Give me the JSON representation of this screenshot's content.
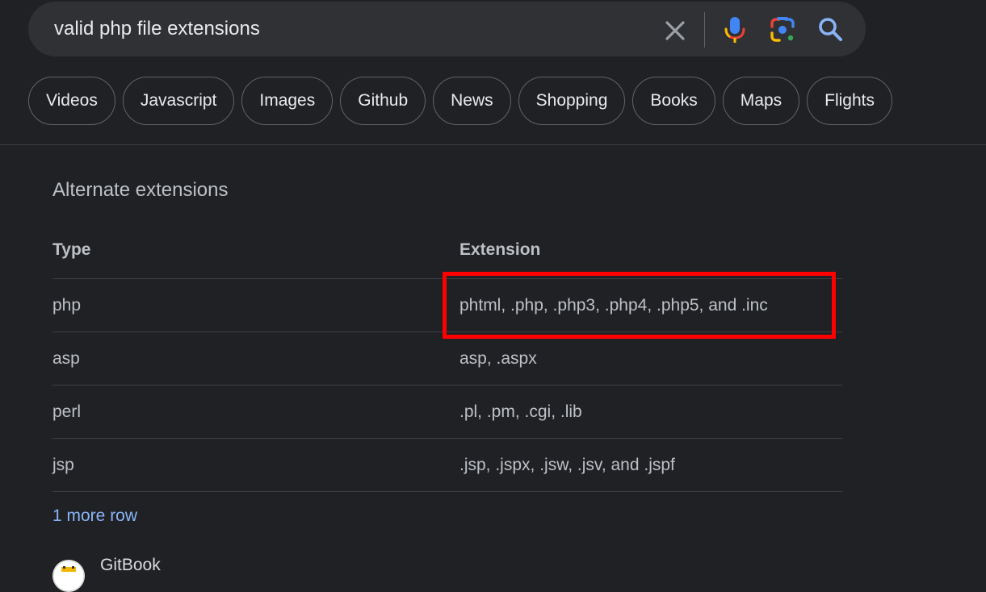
{
  "search": {
    "query": "valid php file extensions"
  },
  "chips": [
    "Videos",
    "Javascript",
    "Images",
    "Github",
    "News",
    "Shopping",
    "Books",
    "Maps",
    "Flights"
  ],
  "section": {
    "title": "Alternate extensions"
  },
  "table": {
    "headers": [
      "Type",
      "Extension"
    ],
    "rows": [
      [
        "php",
        "phtml, .php, .php3, .php4, .php5, and .inc"
      ],
      [
        "asp",
        "asp, .aspx"
      ],
      [
        "perl",
        ".pl, .pm, .cgi, .lib"
      ],
      [
        "jsp",
        ".jsp, .jspx, .jsw, .jsv, and .jspf"
      ]
    ]
  },
  "more_rows_label": "1 more row",
  "source": {
    "name": "GitBook"
  },
  "colors": {
    "background": "#202124",
    "link": "#8ab4f8",
    "highlight": "#ff0000"
  },
  "icons": [
    "close-icon",
    "microphone-icon",
    "google-lens-icon",
    "search-icon"
  ]
}
